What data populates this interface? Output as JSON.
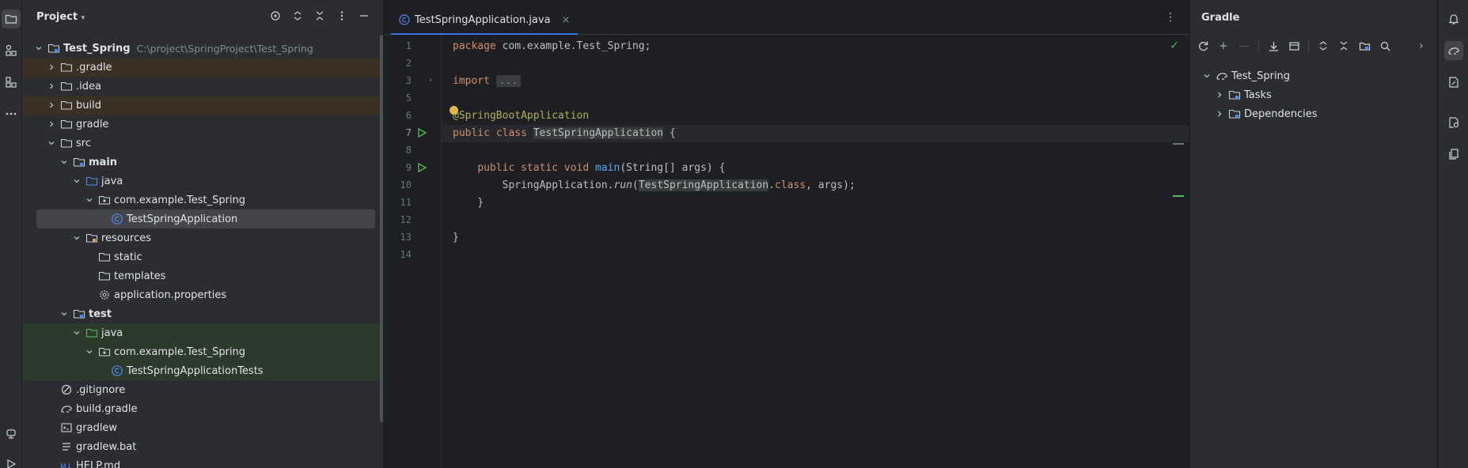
{
  "project_panel": {
    "title": "Project",
    "tree": [
      {
        "label": "Test_Spring",
        "path": "C:\\project\\SpringProject\\Test_Spring",
        "icon": "module-folder-icon",
        "level": 0,
        "expanded": true,
        "bold": true
      },
      {
        "label": ".gradle",
        "icon": "folder-icon",
        "level": 1,
        "expanded": false,
        "style": "excluded"
      },
      {
        "label": ".idea",
        "icon": "folder-icon",
        "level": 1,
        "expanded": false
      },
      {
        "label": "build",
        "icon": "folder-icon",
        "level": 1,
        "expanded": false,
        "style": "excluded"
      },
      {
        "label": "gradle",
        "icon": "folder-icon",
        "level": 1,
        "expanded": false
      },
      {
        "label": "src",
        "icon": "folder-icon",
        "level": 1,
        "expanded": true
      },
      {
        "label": "main",
        "icon": "module-folder-icon",
        "level": 2,
        "expanded": true,
        "bold": true
      },
      {
        "label": "java",
        "icon": "source-folder-icon",
        "level": 3,
        "expanded": true
      },
      {
        "label": "com.example.Test_Spring",
        "icon": "package-icon",
        "level": 4,
        "expanded": true
      },
      {
        "label": "TestSpringApplication",
        "icon": "class-icon",
        "level": 5,
        "selected": true
      },
      {
        "label": "resources",
        "icon": "resources-folder-icon",
        "level": 3,
        "expanded": true
      },
      {
        "label": "static",
        "icon": "folder-icon",
        "level": 4
      },
      {
        "label": "templates",
        "icon": "folder-icon",
        "level": 4
      },
      {
        "label": "application.properties",
        "icon": "settings-file-icon",
        "level": 4
      },
      {
        "label": "test",
        "icon": "module-folder-icon",
        "level": 2,
        "expanded": true,
        "bold": true
      },
      {
        "label": "java",
        "icon": "test-folder-icon",
        "level": 3,
        "expanded": true,
        "style": "testsrc"
      },
      {
        "label": "com.example.Test_Spring",
        "icon": "package-icon",
        "level": 4,
        "expanded": true,
        "style": "testsrc"
      },
      {
        "label": "TestSpringApplicationTests",
        "icon": "class-icon",
        "level": 5,
        "style": "testsrc"
      },
      {
        "label": ".gitignore",
        "icon": "ignore-file-icon",
        "level": 1
      },
      {
        "label": "build.gradle",
        "icon": "gradle-file-icon",
        "level": 1
      },
      {
        "label": "gradlew",
        "icon": "terminal-file-icon",
        "level": 1
      },
      {
        "label": "gradlew.bat",
        "icon": "text-file-icon",
        "level": 1
      },
      {
        "label": "HELP.md",
        "icon": "markdown-file-icon",
        "level": 1
      }
    ]
  },
  "editor": {
    "tab_label": "TestSpringApplication.java",
    "tab_close": "×",
    "menu": "⋮",
    "lines": [
      {
        "n": "1",
        "html": "<span class=\"kw\">package</span> com.example.Test_Spring;"
      },
      {
        "n": "2",
        "html": ""
      },
      {
        "n": "3",
        "html": "<span class=\"kw\">import</span> <span class=\"fold-box\">...</span>"
      },
      {
        "n": "5",
        "html": ""
      },
      {
        "n": "6",
        "html": "<span class=\"ann\">@SpringBootApplication</span>"
      },
      {
        "n": "7",
        "html": "<span class=\"kw\">public class</span> <span class=\"hl\">TestSpringApplication</span> {",
        "current": true
      },
      {
        "n": "8",
        "html": ""
      },
      {
        "n": "9",
        "html": "    <span class=\"kw\">public static void</span> <span class=\"fn\">main</span>(String[] args) {"
      },
      {
        "n": "10",
        "html": "        SpringApplication.<span class=\"it\">run</span>(<span class=\"hl\">TestSpringApplication</span>.<span class=\"kw\">class</span>, args);"
      },
      {
        "n": "11",
        "html": "    }"
      },
      {
        "n": "12",
        "html": ""
      },
      {
        "n": "13",
        "html": "}"
      },
      {
        "n": "14",
        "html": ""
      }
    ]
  },
  "gradle_panel": {
    "title": "Gradle",
    "tree": [
      {
        "label": "Test_Spring",
        "icon": "gradle-elephant-icon",
        "level": 0,
        "expanded": true
      },
      {
        "label": "Tasks",
        "icon": "tasks-folder-icon",
        "level": 1,
        "expanded": false
      },
      {
        "label": "Dependencies",
        "icon": "dependencies-folder-icon",
        "level": 1,
        "expanded": false
      }
    ]
  },
  "colors": {
    "accent": "#3574f0",
    "run_green": "#5fb865",
    "excluded_bg": "#3a3024",
    "test_bg": "#2b3a2b"
  }
}
